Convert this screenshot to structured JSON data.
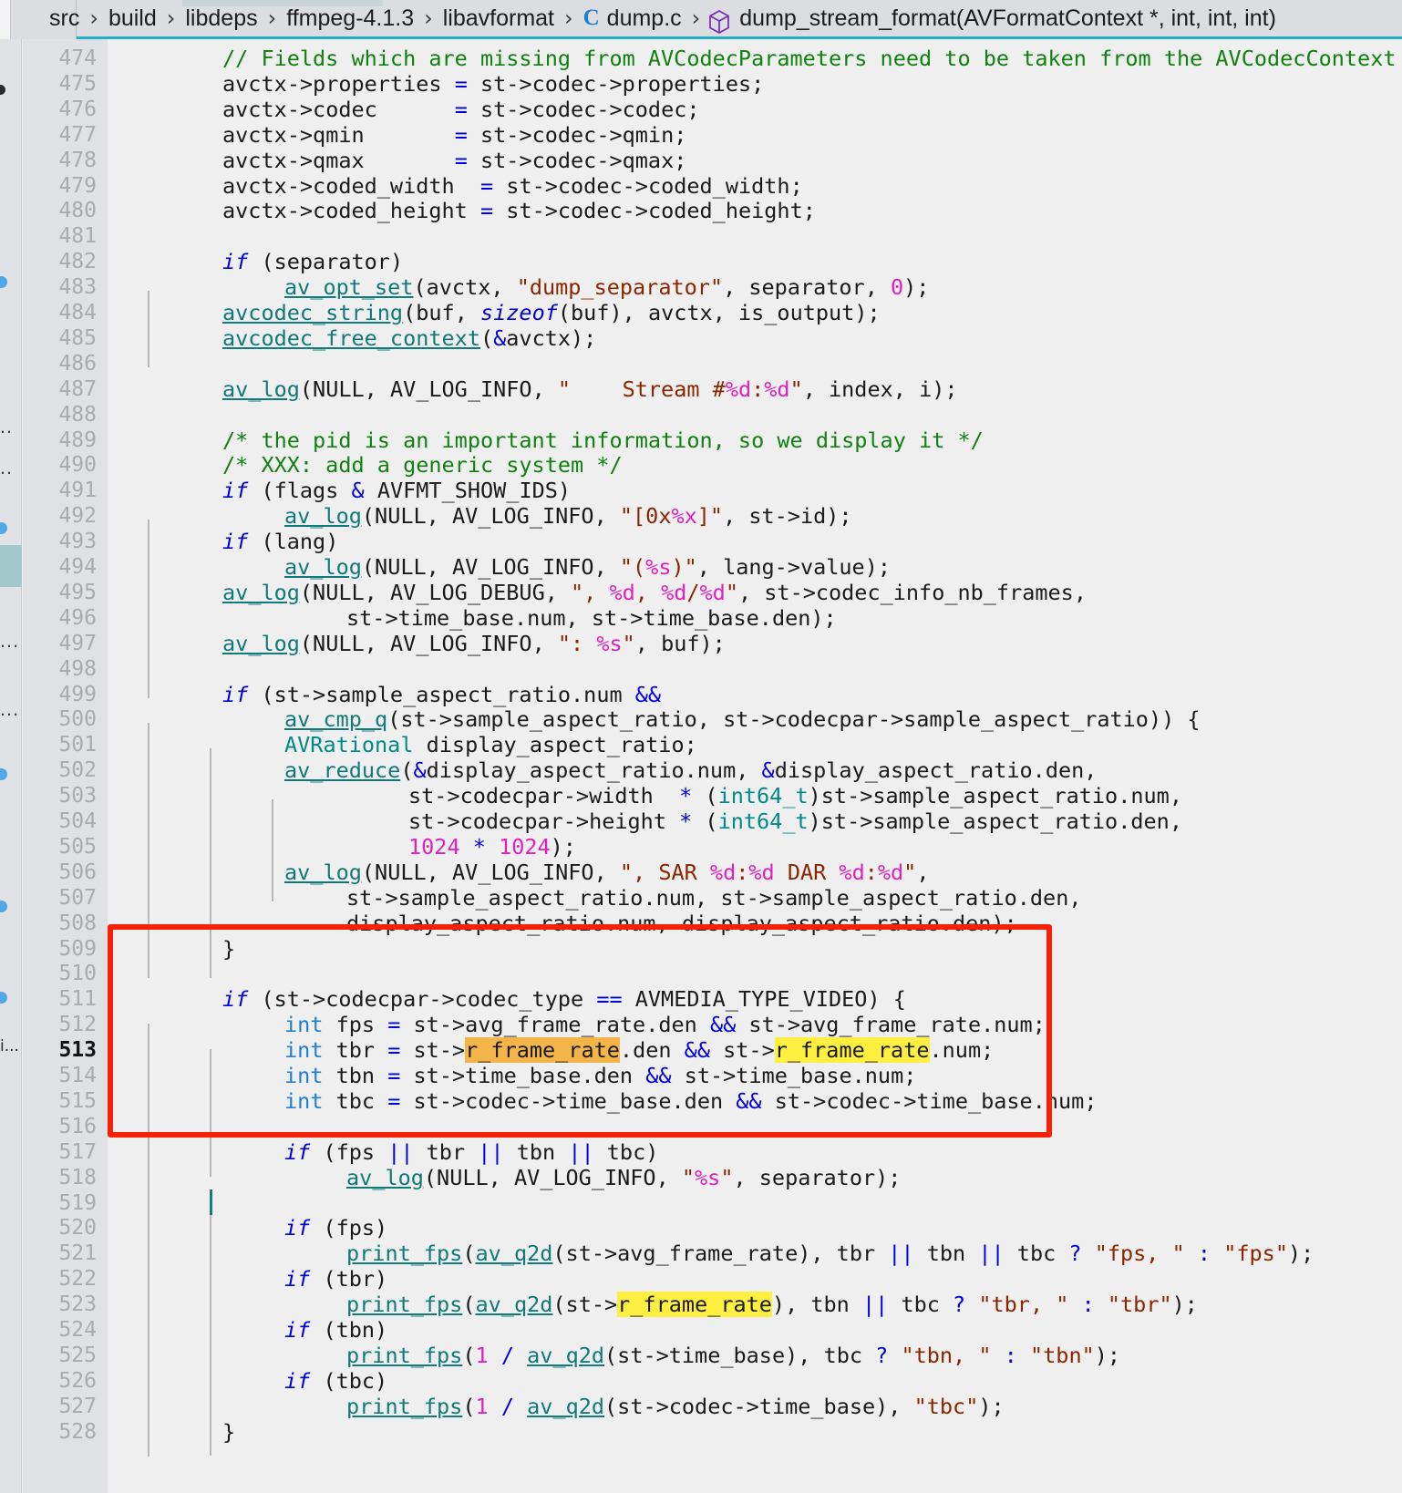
{
  "breadcrumb": {
    "items": [
      {
        "label": "src",
        "icon": null
      },
      {
        "label": "build",
        "icon": null
      },
      {
        "label": "libdeps",
        "icon": null
      },
      {
        "label": "ffmpeg-4.1.3",
        "icon": null
      },
      {
        "label": "libavformat",
        "icon": null
      },
      {
        "label": "dump.c",
        "icon": "c-file-icon"
      },
      {
        "label": "dump_stream_format(AVFormatContext *, int, int, int)",
        "icon": "method-cube-icon"
      }
    ],
    "separator": "›"
  },
  "editor": {
    "first_line": 474,
    "current_line": 513,
    "highlight_term": "r_frame_rate",
    "colors": {
      "background": "#efefef",
      "gutter": "#dfe1e5",
      "comment": "#108010",
      "keyword": "#0000d8",
      "type": "#008a8a",
      "int_keyword": "#1f7fd4",
      "function": "#0f7a78",
      "string": "#8b2500",
      "format_spec": "#e020c0",
      "number": "#e020c0",
      "operator": "#0000e0",
      "highlight_current": "#f3b44a",
      "highlight_other": "#ffef40",
      "annotation_box": "#f92008",
      "breadcrumb_accent": "#21b0c4"
    },
    "lines": [
      {
        "n": 474,
        "indent": 1,
        "t": "// Fields which are missing from AVCodecParameters need to be taken from the AVCodecContext"
      },
      {
        "n": 475,
        "indent": 1,
        "t": "avctx->properties = st->codec->properties;"
      },
      {
        "n": 476,
        "indent": 1,
        "t": "avctx->codec      = st->codec->codec;"
      },
      {
        "n": 477,
        "indent": 1,
        "t": "avctx->qmin       = st->codec->qmin;"
      },
      {
        "n": 478,
        "indent": 1,
        "t": "avctx->qmax       = st->codec->qmax;"
      },
      {
        "n": 479,
        "indent": 1,
        "t": "avctx->coded_width  = st->codec->coded_width;"
      },
      {
        "n": 480,
        "indent": 1,
        "t": "avctx->coded_height = st->codec->coded_height;"
      },
      {
        "n": 481,
        "indent": 0,
        "t": ""
      },
      {
        "n": 482,
        "indent": 1,
        "t": "if (separator)"
      },
      {
        "n": 483,
        "indent": 2,
        "t": "av_opt_set(avctx, \"dump_separator\", separator, 0);"
      },
      {
        "n": 484,
        "indent": 1,
        "t": "avcodec_string(buf, sizeof(buf), avctx, is_output);"
      },
      {
        "n": 485,
        "indent": 1,
        "t": "avcodec_free_context(&avctx);"
      },
      {
        "n": 486,
        "indent": 0,
        "t": ""
      },
      {
        "n": 487,
        "indent": 1,
        "t": "av_log(NULL, AV_LOG_INFO, \"    Stream #%d:%d\", index, i);"
      },
      {
        "n": 488,
        "indent": 0,
        "t": ""
      },
      {
        "n": 489,
        "indent": 1,
        "t": "/* the pid is an important information, so we display it */"
      },
      {
        "n": 490,
        "indent": 1,
        "t": "/* XXX: add a generic system */"
      },
      {
        "n": 491,
        "indent": 1,
        "t": "if (flags & AVFMT_SHOW_IDS)"
      },
      {
        "n": 492,
        "indent": 2,
        "t": "av_log(NULL, AV_LOG_INFO, \"[0x%x]\", st->id);"
      },
      {
        "n": 493,
        "indent": 1,
        "t": "if (lang)"
      },
      {
        "n": 494,
        "indent": 2,
        "t": "av_log(NULL, AV_LOG_INFO, \"(%s)\", lang->value);"
      },
      {
        "n": 495,
        "indent": 1,
        "t": "av_log(NULL, AV_LOG_DEBUG, \", %d, %d/%d\", st->codec_info_nb_frames,"
      },
      {
        "n": 496,
        "indent": 3,
        "t": "st->time_base.num, st->time_base.den);"
      },
      {
        "n": 497,
        "indent": 1,
        "t": "av_log(NULL, AV_LOG_INFO, \": %s\", buf);"
      },
      {
        "n": 498,
        "indent": 0,
        "t": ""
      },
      {
        "n": 499,
        "indent": 1,
        "t": "if (st->sample_aspect_ratio.num &&"
      },
      {
        "n": 500,
        "indent": 2,
        "t": "av_cmp_q(st->sample_aspect_ratio, st->codecpar->sample_aspect_ratio)) {"
      },
      {
        "n": 501,
        "indent": 2,
        "t": "AVRational display_aspect_ratio;"
      },
      {
        "n": 502,
        "indent": 2,
        "t": "av_reduce(&display_aspect_ratio.num, &display_aspect_ratio.den,"
      },
      {
        "n": 503,
        "indent": 4,
        "t": "st->codecpar->width  * (int64_t)st->sample_aspect_ratio.num,"
      },
      {
        "n": 504,
        "indent": 4,
        "t": "st->codecpar->height * (int64_t)st->sample_aspect_ratio.den,"
      },
      {
        "n": 505,
        "indent": 4,
        "t": "1024 * 1024);"
      },
      {
        "n": 506,
        "indent": 2,
        "t": "av_log(NULL, AV_LOG_INFO, \", SAR %d:%d DAR %d:%d\","
      },
      {
        "n": 507,
        "indent": 3,
        "t": "st->sample_aspect_ratio.num, st->sample_aspect_ratio.den,"
      },
      {
        "n": 508,
        "indent": 3,
        "t": "display_aspect_ratio.num, display_aspect_ratio.den);"
      },
      {
        "n": 509,
        "indent": 1,
        "t": "}"
      },
      {
        "n": 510,
        "indent": 0,
        "t": ""
      },
      {
        "n": 511,
        "indent": 1,
        "t": "if (st->codecpar->codec_type == AVMEDIA_TYPE_VIDEO) {"
      },
      {
        "n": 512,
        "indent": 2,
        "t": "int fps = st->avg_frame_rate.den && st->avg_frame_rate.num;"
      },
      {
        "n": 513,
        "indent": 2,
        "t": "int tbr = st->r_frame_rate.den && st->r_frame_rate.num;"
      },
      {
        "n": 514,
        "indent": 2,
        "t": "int tbn = st->time_base.den && st->time_base.num;"
      },
      {
        "n": 515,
        "indent": 2,
        "t": "int tbc = st->codec->time_base.den && st->codec->time_base.num;"
      },
      {
        "n": 516,
        "indent": 0,
        "t": ""
      },
      {
        "n": 517,
        "indent": 2,
        "t": "if (fps || tbr || tbn || tbc)"
      },
      {
        "n": 518,
        "indent": 3,
        "t": "av_log(NULL, AV_LOG_INFO, \"%s\", separator);"
      },
      {
        "n": 519,
        "indent": 0,
        "t": ""
      },
      {
        "n": 520,
        "indent": 2,
        "t": "if (fps)"
      },
      {
        "n": 521,
        "indent": 3,
        "t": "print_fps(av_q2d(st->avg_frame_rate), tbr || tbn || tbc ? \"fps, \" : \"fps\");"
      },
      {
        "n": 522,
        "indent": 2,
        "t": "if (tbr)"
      },
      {
        "n": 523,
        "indent": 3,
        "t": "print_fps(av_q2d(st->r_frame_rate), tbn || tbc ? \"tbr, \" : \"tbr\");"
      },
      {
        "n": 524,
        "indent": 2,
        "t": "if (tbn)"
      },
      {
        "n": 525,
        "indent": 3,
        "t": "print_fps(1 / av_q2d(st->time_base), tbc ? \"tbn, \" : \"tbn\");"
      },
      {
        "n": 526,
        "indent": 2,
        "t": "if (tbc)"
      },
      {
        "n": 527,
        "indent": 3,
        "t": "print_fps(1 / av_q2d(st->codec->time_base), \"tbc\");"
      },
      {
        "n": 528,
        "indent": 1,
        "t": "}"
      }
    ]
  },
  "annotation": {
    "type": "red-rectangle",
    "covers_lines": "509-515",
    "color": "#f92008"
  },
  "left_strip": {
    "markers": [
      "bookmark-dot",
      "change-dot",
      "change-dot",
      "ellipsis-marker",
      "ellipsis-marker",
      "change-dot",
      "selection-block",
      "ellipsis-marker",
      "change-dot",
      "ellipsis-marker",
      "change-dot",
      "info-marker"
    ]
  }
}
